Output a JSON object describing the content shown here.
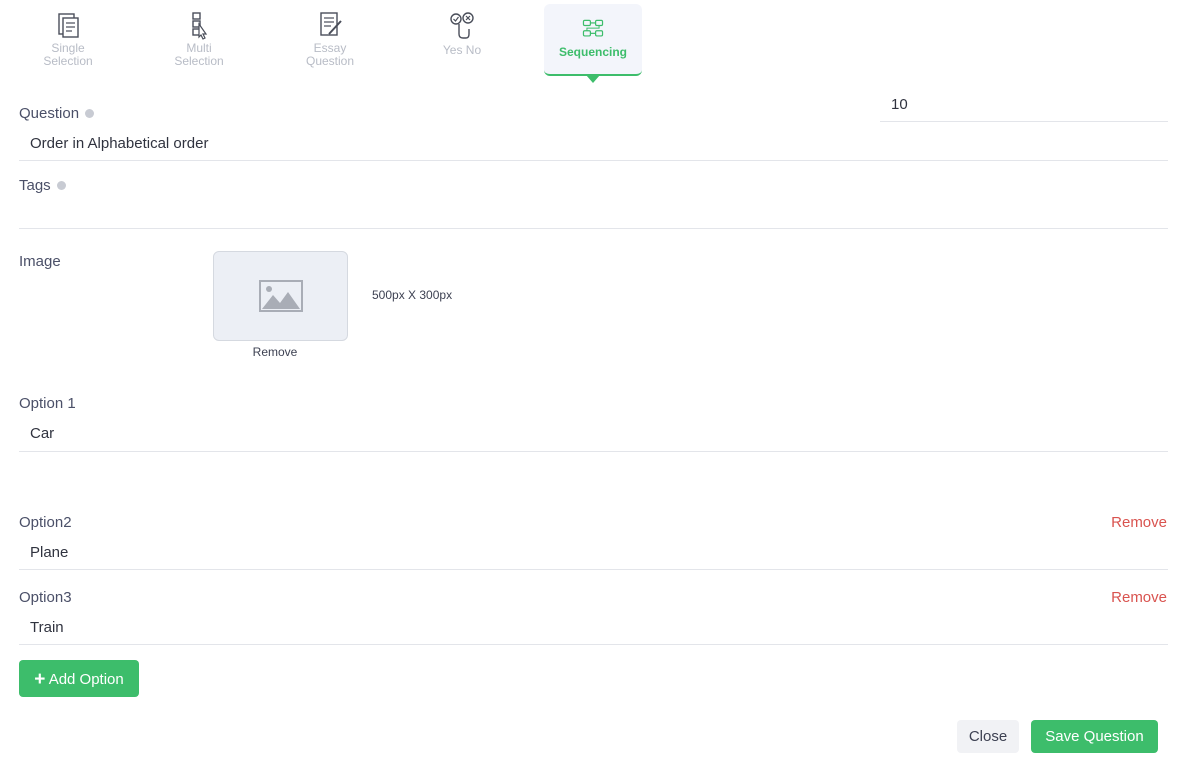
{
  "question_types": [
    {
      "label": "Single\nSelection",
      "icon": "document-checklist-icon",
      "active": false
    },
    {
      "label": "Multi\nSelection",
      "icon": "multi-select-icon",
      "active": false
    },
    {
      "label": "Essay\nQuestion",
      "icon": "essay-document-icon",
      "active": false
    },
    {
      "label": "Yes No",
      "icon": "yes-no-icon",
      "active": false
    },
    {
      "label": "Sequencing",
      "icon": "sequencing-icon",
      "active": true
    }
  ],
  "question": {
    "label": "Question",
    "value": "Order in Alphabetical order"
  },
  "points": {
    "value": "10"
  },
  "tags": {
    "label": "Tags",
    "value": ""
  },
  "image": {
    "label": "Image",
    "size_hint": "500px X 300px",
    "remove_label": "Remove"
  },
  "options": [
    {
      "label": "Option 1",
      "value": "Car",
      "removable": false
    },
    {
      "label": "Option2",
      "value": "Plane",
      "removable": true
    },
    {
      "label": "Option3",
      "value": "Train",
      "removable": true
    }
  ],
  "option_remove_label": "Remove",
  "add_option_label": "Add Option",
  "close_label": "Close",
  "save_label": "Save Question",
  "colors": {
    "accent": "#3dbd6b",
    "danger": "#d9534f",
    "muted": "#b8bcc6"
  }
}
